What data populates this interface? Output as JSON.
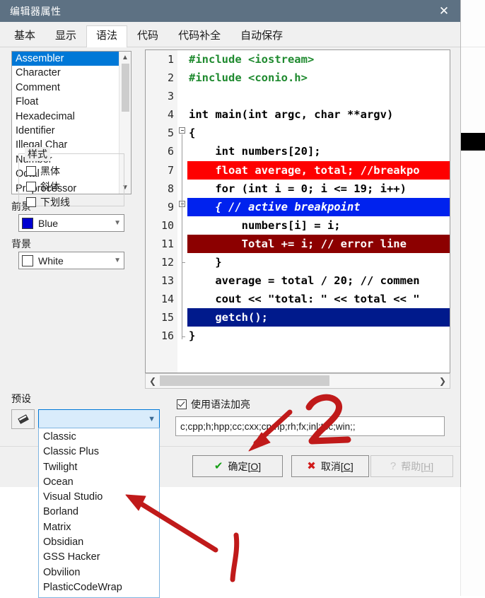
{
  "window": {
    "title": "编辑器属性",
    "close_label": "✕"
  },
  "tabs": [
    {
      "label": "基本",
      "active": false
    },
    {
      "label": "显示",
      "active": false
    },
    {
      "label": "语法",
      "active": true
    },
    {
      "label": "代码",
      "active": false
    },
    {
      "label": "代码补全",
      "active": false
    },
    {
      "label": "自动保存",
      "active": false
    }
  ],
  "element_list": {
    "items": [
      "Assembler",
      "Character",
      "Comment",
      "Float",
      "Hexadecimal",
      "Identifier",
      "Illegal Char",
      "Number",
      "Octal",
      "Preprocessor"
    ],
    "selected": "Assembler",
    "scroll_up_icon": "chevron-up-icon",
    "scroll_down_icon": "chevron-down-icon"
  },
  "foreground": {
    "label": "前景",
    "value": "Blue",
    "swatch_color": "#0000d0"
  },
  "background": {
    "label": "背景",
    "value": "White",
    "swatch_color": "#ffffff"
  },
  "style_group": {
    "label": "样式",
    "options": [
      {
        "label": "黑体",
        "checked": false
      },
      {
        "label": "斜体",
        "checked": false
      },
      {
        "label": "下划线",
        "checked": false
      }
    ]
  },
  "preset": {
    "label": "预设",
    "value": "",
    "brush_icon": "eraser-icon",
    "chevron": "chevron-down-icon",
    "options": [
      "Classic",
      "Classic Plus",
      "Twilight",
      "Ocean",
      "Visual Studio",
      "Borland",
      "Matrix",
      "Obsidian",
      "GSS Hacker",
      "Obvilion",
      "PlasticCodeWrap"
    ],
    "dropdown_open": true
  },
  "syntax_highlight": {
    "label": "使用语法加亮",
    "checked": true
  },
  "extensions": {
    "value": "c;cpp;h;hpp;cc;cxx;cp;hp;rh;fx;inl;tcc;win;;"
  },
  "editor": {
    "line_numbers": [
      "1",
      "2",
      "3",
      "4",
      "5",
      "6",
      "7",
      "8",
      "9",
      "10",
      "11",
      "12",
      "13",
      "14",
      "15",
      "16"
    ],
    "lines": [
      {
        "n": "1",
        "fold": "",
        "hl": "",
        "text": "#include <iostream>"
      },
      {
        "n": "2",
        "fold": "",
        "hl": "",
        "text": "#include <conio.h>"
      },
      {
        "n": "3",
        "fold": "",
        "hl": "",
        "text": ""
      },
      {
        "n": "4",
        "fold": "",
        "hl": "",
        "text": "int main(int argc, char **argv)"
      },
      {
        "n": "5",
        "fold": "box",
        "hl": "",
        "text": "{"
      },
      {
        "n": "6",
        "fold": "line",
        "hl": "",
        "text": "    int numbers[20];"
      },
      {
        "n": "7",
        "fold": "line",
        "hl": "red",
        "text": "    float average, total; //breakpo"
      },
      {
        "n": "8",
        "fold": "line",
        "hl": "",
        "text": "    for (int i = 0; i <= 19; i++)"
      },
      {
        "n": "9",
        "fold": "box",
        "hl": "blue",
        "text": "    { // active breakpoint"
      },
      {
        "n": "10",
        "fold": "line",
        "hl": "",
        "text": "        numbers[i] = i;"
      },
      {
        "n": "11",
        "fold": "line",
        "hl": "dred",
        "text": "        Total += i; // error line"
      },
      {
        "n": "12",
        "fold": "end",
        "hl": "",
        "text": "    }"
      },
      {
        "n": "13",
        "fold": "line",
        "hl": "",
        "text": "    average = total / 20; // commen"
      },
      {
        "n": "14",
        "fold": "line",
        "hl": "",
        "text": "    cout << \"total: \" << total << \""
      },
      {
        "n": "15",
        "fold": "line",
        "hl": "navy",
        "text": "    getch();"
      },
      {
        "n": "16",
        "fold": "end",
        "hl": "",
        "text": "}"
      }
    ],
    "hscroll_left_icon": "chevron-left-icon",
    "hscroll_right_icon": "chevron-right-icon"
  },
  "footer": {
    "ok": {
      "prefix": "确定[",
      "key": "O",
      "suffix": "]",
      "icon": "check-icon"
    },
    "cancel": {
      "prefix": "取消[",
      "key": "C",
      "suffix": "]",
      "icon": "cross-icon"
    },
    "help": {
      "prefix": "帮助[",
      "key": "H",
      "suffix": "]",
      "icon": "question-icon",
      "disabled": true
    }
  },
  "annotations": [
    {
      "label": "1",
      "color": "#c01a1a",
      "points_to": "Borland"
    },
    {
      "label": "2",
      "color": "#c01a1a",
      "points_to": "确定[O]"
    }
  ]
}
